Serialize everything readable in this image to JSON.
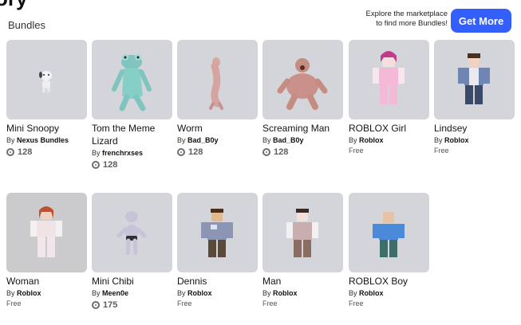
{
  "header": {
    "title": "ory",
    "section": "Bundles",
    "promo_line1": "Explore the marketplace",
    "promo_line2": "to find more Bundles!",
    "cta_label": "Get More"
  },
  "colors": {
    "accent": "#335fff",
    "card_bg": "#d4d5da"
  },
  "bundles": [
    {
      "name": "Mini Snoopy",
      "by": "By",
      "creator": "Nexus Bundles",
      "price": "128",
      "free": ""
    },
    {
      "name": "Tom the Meme Lizard",
      "by": "By",
      "creator": "frenchrxses",
      "price": "128",
      "free": ""
    },
    {
      "name": "Worm",
      "by": "By",
      "creator": "Bad_B0y",
      "price": "128",
      "free": ""
    },
    {
      "name": "Screaming Man",
      "by": "By",
      "creator": "Bad_B0y",
      "price": "128",
      "free": ""
    },
    {
      "name": "ROBLOX Girl",
      "by": "By",
      "creator": "Roblox",
      "price": "",
      "free": "Free"
    },
    {
      "name": "Lindsey",
      "by": "By",
      "creator": "Roblox",
      "price": "",
      "free": "Free"
    },
    {
      "name": "Woman",
      "by": "By",
      "creator": "Roblox",
      "price": "",
      "free": "Free"
    },
    {
      "name": "Mini Chibi",
      "by": "By",
      "creator": "Meen0e",
      "price": "175",
      "free": ""
    },
    {
      "name": "Dennis",
      "by": "By",
      "creator": "Roblox",
      "price": "",
      "free": "Free"
    },
    {
      "name": "Man",
      "by": "By",
      "creator": "Roblox",
      "price": "",
      "free": "Free"
    },
    {
      "name": "ROBLOX Boy",
      "by": "By",
      "creator": "Roblox",
      "price": "",
      "free": "Free"
    }
  ]
}
